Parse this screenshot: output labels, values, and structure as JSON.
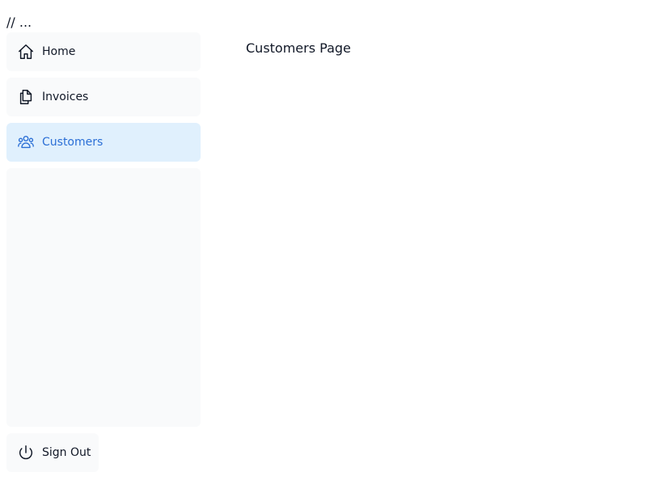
{
  "top_comment": "// ...",
  "sidebar": {
    "items": [
      {
        "label": "Home",
        "icon": "home-icon",
        "active": false
      },
      {
        "label": "Invoices",
        "icon": "document-duplicate-icon",
        "active": false
      },
      {
        "label": "Customers",
        "icon": "user-group-icon",
        "active": true
      }
    ],
    "signout_label": "Sign Out"
  },
  "main": {
    "title": "Customers Page"
  },
  "colors": {
    "active_bg": "#e0f0fd",
    "active_text": "#2b6fd6",
    "item_bg": "#f9fafb",
    "text": "#111827"
  }
}
